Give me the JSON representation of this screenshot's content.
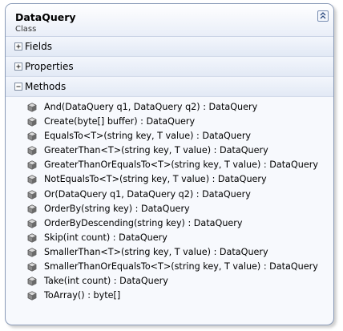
{
  "class_box": {
    "title": "DataQuery",
    "subtitle": "Class",
    "collapse_icon": "double-chevron-up-icon"
  },
  "sections": {
    "fields": {
      "label": "Fields",
      "state": "collapsed"
    },
    "properties": {
      "label": "Properties",
      "state": "collapsed"
    },
    "methods": {
      "label": "Methods",
      "state": "expanded"
    }
  },
  "methods": [
    "And(DataQuery q1, DataQuery q2) : DataQuery",
    "Create(byte[] buffer) : DataQuery",
    "EqualsTo<T>(string key, T value) : DataQuery",
    "GreaterThan<T>(string key, T value) : DataQuery",
    "GreaterThanOrEqualsTo<T>(string key, T value) : DataQuery",
    "NotEqualsTo<T>(string key, T value) : DataQuery",
    "Or(DataQuery q1, DataQuery q2) : DataQuery",
    "OrderBy(string key) : DataQuery",
    "OrderByDescending(string key) : DataQuery",
    "Skip(int count) : DataQuery",
    "SmallerThan<T>(string key, T value) : DataQuery",
    "SmallerThanOrEqualsTo<T>(string key, T value) : DataQuery",
    "Take(int count) : DataQuery",
    "ToArray() : byte[]"
  ],
  "method_icon": "method-cube-icon",
  "colors": {
    "border": "#8a9bb8",
    "header_gradient_bottom": "#e9eef8",
    "method_icon": "#6e6e6e"
  }
}
